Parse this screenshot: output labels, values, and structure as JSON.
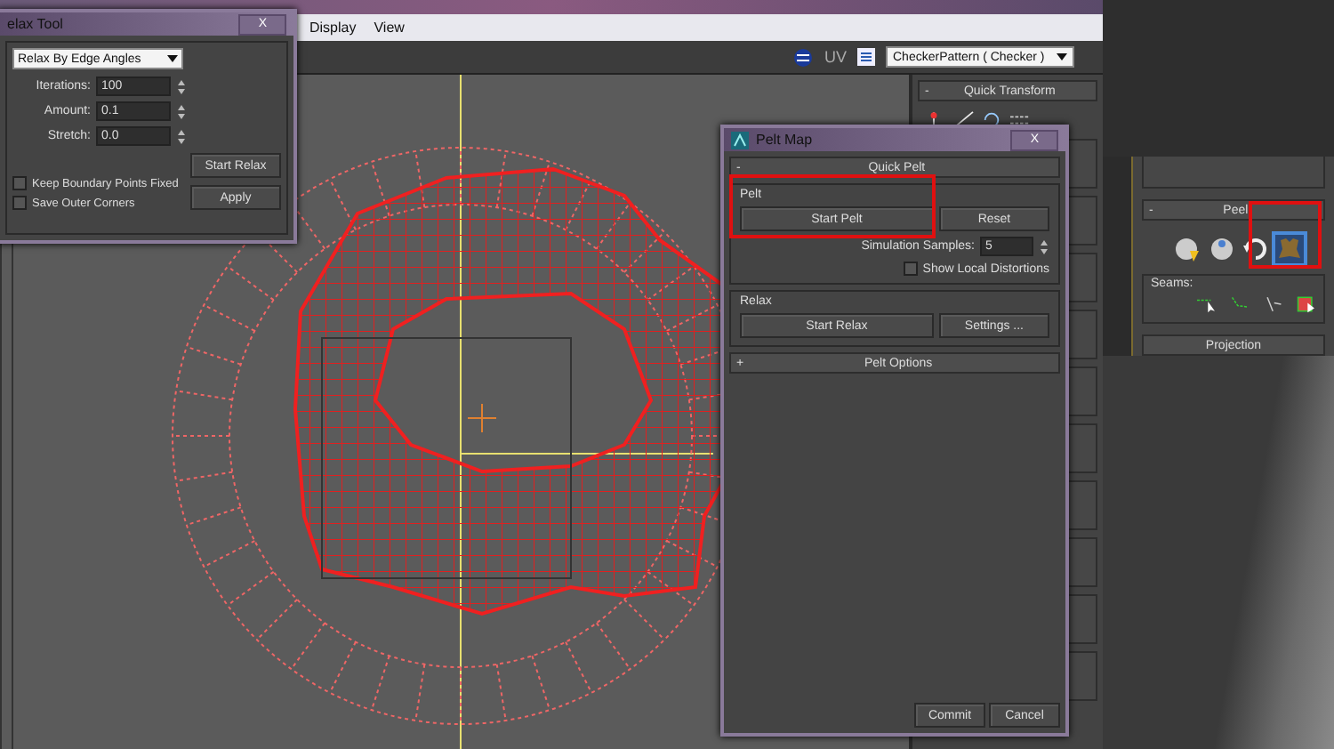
{
  "editor": {
    "menu": [
      {
        "label": "Display"
      },
      {
        "label": "View"
      }
    ],
    "uv_label": "UV",
    "texture_dropdown": {
      "value": "CheckerPattern ( Checker )"
    }
  },
  "quick_transform": {
    "toggle": "-",
    "title": "Quick Transform"
  },
  "relax_tool": {
    "title": "elax Tool",
    "close": "X",
    "method": "Relax By Edge Angles",
    "fields": [
      {
        "label": "Iterations:",
        "value": "100"
      },
      {
        "label": "Amount:",
        "value": "0.1"
      },
      {
        "label": "Stretch:",
        "value": "0.0"
      }
    ],
    "options": [
      {
        "label": "Keep Boundary Points Fixed",
        "checked": false
      },
      {
        "label": "Save Outer Corners",
        "checked": false
      }
    ],
    "buttons": [
      "Start Relax",
      "Apply"
    ]
  },
  "pelt_map": {
    "title": "Pelt Map",
    "close": "X",
    "quick_pelt": {
      "toggle": "-",
      "title": "Quick Pelt"
    },
    "pelt_group": {
      "title": "Pelt",
      "start_button": "Start Pelt",
      "reset_button": "Reset",
      "samples_label": "Simulation Samples:",
      "samples_value": "5",
      "distortions": {
        "label": "Show Local Distortions",
        "checked": false
      }
    },
    "relax_group": {
      "title": "Relax",
      "start_button": "Start Relax",
      "settings_button": "Settings ..."
    },
    "options_rollout": {
      "toggle": "+",
      "title": "Pelt Options"
    },
    "buttons": [
      "Commit",
      "Cancel"
    ]
  },
  "peel_panel": {
    "toggle": "-",
    "title": "Peel",
    "tools": [
      {
        "kind": "quick",
        "selected": false
      },
      {
        "kind": "sphere",
        "selected": false
      },
      {
        "kind": "reset",
        "selected": false
      },
      {
        "kind": "pelt",
        "selected": true
      }
    ],
    "seams_label": "Seams:",
    "next_rollout": "Projection"
  }
}
